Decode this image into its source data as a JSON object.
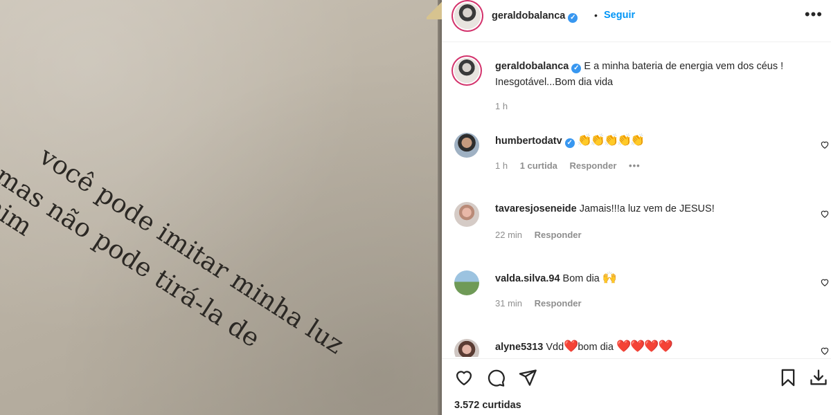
{
  "photo": {
    "line1": "você pode imitar minha luz",
    "line2": "mas não pode tirá-la de mim"
  },
  "header": {
    "username": "geraldobalanca",
    "separator": "•",
    "follow_label": "Seguir",
    "more_label": "•••"
  },
  "caption": {
    "username": "geraldobalanca",
    "text": "E a minha bateria de energia vem dos céus ! Inesgotável...Bom dia vida",
    "time": "1 h"
  },
  "comments": [
    {
      "username": "humbertodatv",
      "verified": true,
      "text": "👏👏👏👏👏",
      "time": "1 h",
      "likes": "1 curtida",
      "reply": "Responder",
      "more": "•••"
    },
    {
      "username": "tavaresjoseneide",
      "text": "Jamais!!!a luz vem de JESUS!",
      "time": "22 min",
      "reply": "Responder"
    },
    {
      "username": "valda.silva.94",
      "text": "Bom dia",
      "emoji": "🙌",
      "time": "31 min",
      "reply": "Responder"
    },
    {
      "username": "alyne5313",
      "text_before": "Vdd",
      "heart": "❤️",
      "text_after": "bom dia",
      "hearts": "❤️❤️❤️❤️"
    }
  ],
  "actions": {
    "like_icon": "heart-icon",
    "comment_icon": "comment-icon",
    "share_icon": "send-icon",
    "save_icon": "bookmark-icon",
    "download_icon": "download-icon"
  },
  "likes_count": "3.572 curtidas",
  "colors": {
    "link": "#0095f6",
    "verified": "#3897f0",
    "meta": "#8e8e8e",
    "text": "#262626"
  }
}
